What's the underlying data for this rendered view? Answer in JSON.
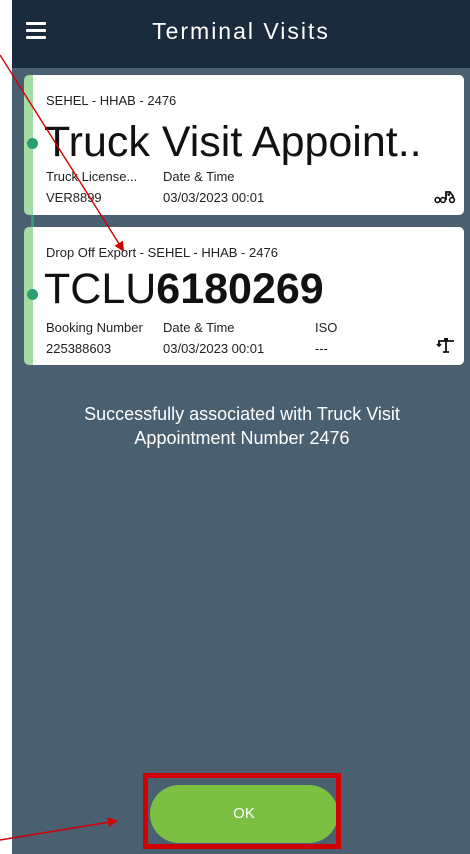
{
  "header": {
    "title": "Terminal Visits",
    "menu_icon": "hamburger-menu-icon"
  },
  "visit_card": {
    "subtitle": "SEHEL - HHAB - 2476",
    "title": "Truck Visit Appoint..",
    "col1_label": "Truck License...",
    "col1_value": "VER8899",
    "col2_label": "Date & Time",
    "col2_value": "03/03/2023 00:01",
    "icon": "truck-icon"
  },
  "container_card": {
    "subtitle": "Drop Off Export - SEHEL - HHAB - 2476",
    "title_prefix": "TCLU",
    "title_number": "6180269",
    "col1_label": "Booking Number",
    "col1_value": "225388603",
    "col2_label": "Date & Time",
    "col2_value": "03/03/2023 00:01",
    "col3_label": "ISO",
    "col3_value": "---",
    "icon": "crane-icon"
  },
  "message": "Successfully associated with Truck Visit Appointment Number 2476",
  "ok_label": "OK",
  "colors": {
    "header_bg": "#1a2b3d",
    "screen_bg": "#4a5f70",
    "accent_green": "#7bc043",
    "timeline": "#2a9d73",
    "annotation_red": "#d10000"
  }
}
